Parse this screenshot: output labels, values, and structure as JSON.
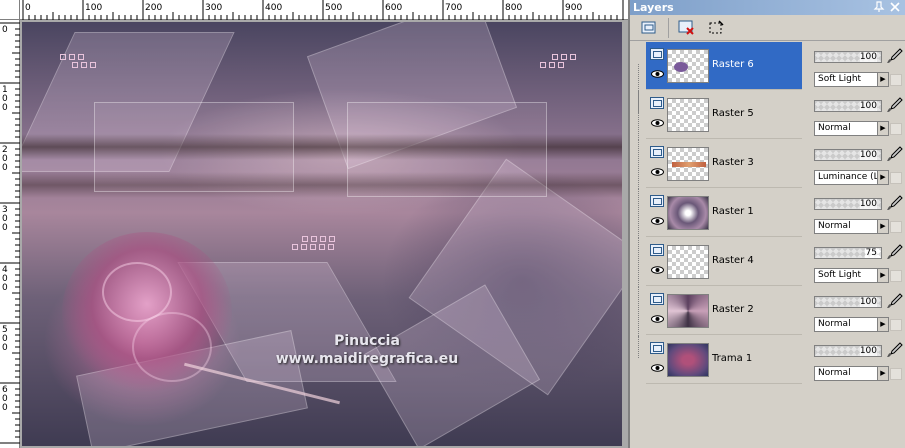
{
  "ruler": {
    "top_labels": [
      "0",
      "100",
      "200",
      "300",
      "400",
      "500",
      "600",
      "700",
      "800",
      "900"
    ],
    "left_labels": [
      "0",
      "1\n0\n0",
      "2\n0\n0",
      "3\n0\n0",
      "4\n0\n0",
      "5\n0\n0",
      "6\n0\n0"
    ]
  },
  "watermark": {
    "line1": "Pinuccia",
    "line2": "www.maidiregrafica.eu"
  },
  "layers_panel": {
    "title": "Layers",
    "layers": [
      {
        "name": "Raster 6",
        "opacity": 100,
        "blend": "Soft Light",
        "selected": true
      },
      {
        "name": "Raster 5",
        "opacity": 100,
        "blend": "Normal",
        "selected": false
      },
      {
        "name": "Raster 3",
        "opacity": 100,
        "blend": "Luminance (L)",
        "selected": false
      },
      {
        "name": "Raster 1",
        "opacity": 100,
        "blend": "Normal",
        "selected": false
      },
      {
        "name": "Raster 4",
        "opacity": 75,
        "blend": "Soft Light",
        "selected": false
      },
      {
        "name": "Raster 2",
        "opacity": 100,
        "blend": "Normal",
        "selected": false
      },
      {
        "name": "Trama 1",
        "opacity": 100,
        "blend": "Normal",
        "selected": false
      }
    ]
  },
  "colors": {
    "selection": "#316ac5",
    "titlebar": "#7e9fc9",
    "panel": "#d4d0c8"
  },
  "icons": [
    "new-layer-icon",
    "delete-layer-icon",
    "selection-icon",
    "eye-icon",
    "brush-icon",
    "lock-icon",
    "pin-icon",
    "close-icon"
  ]
}
